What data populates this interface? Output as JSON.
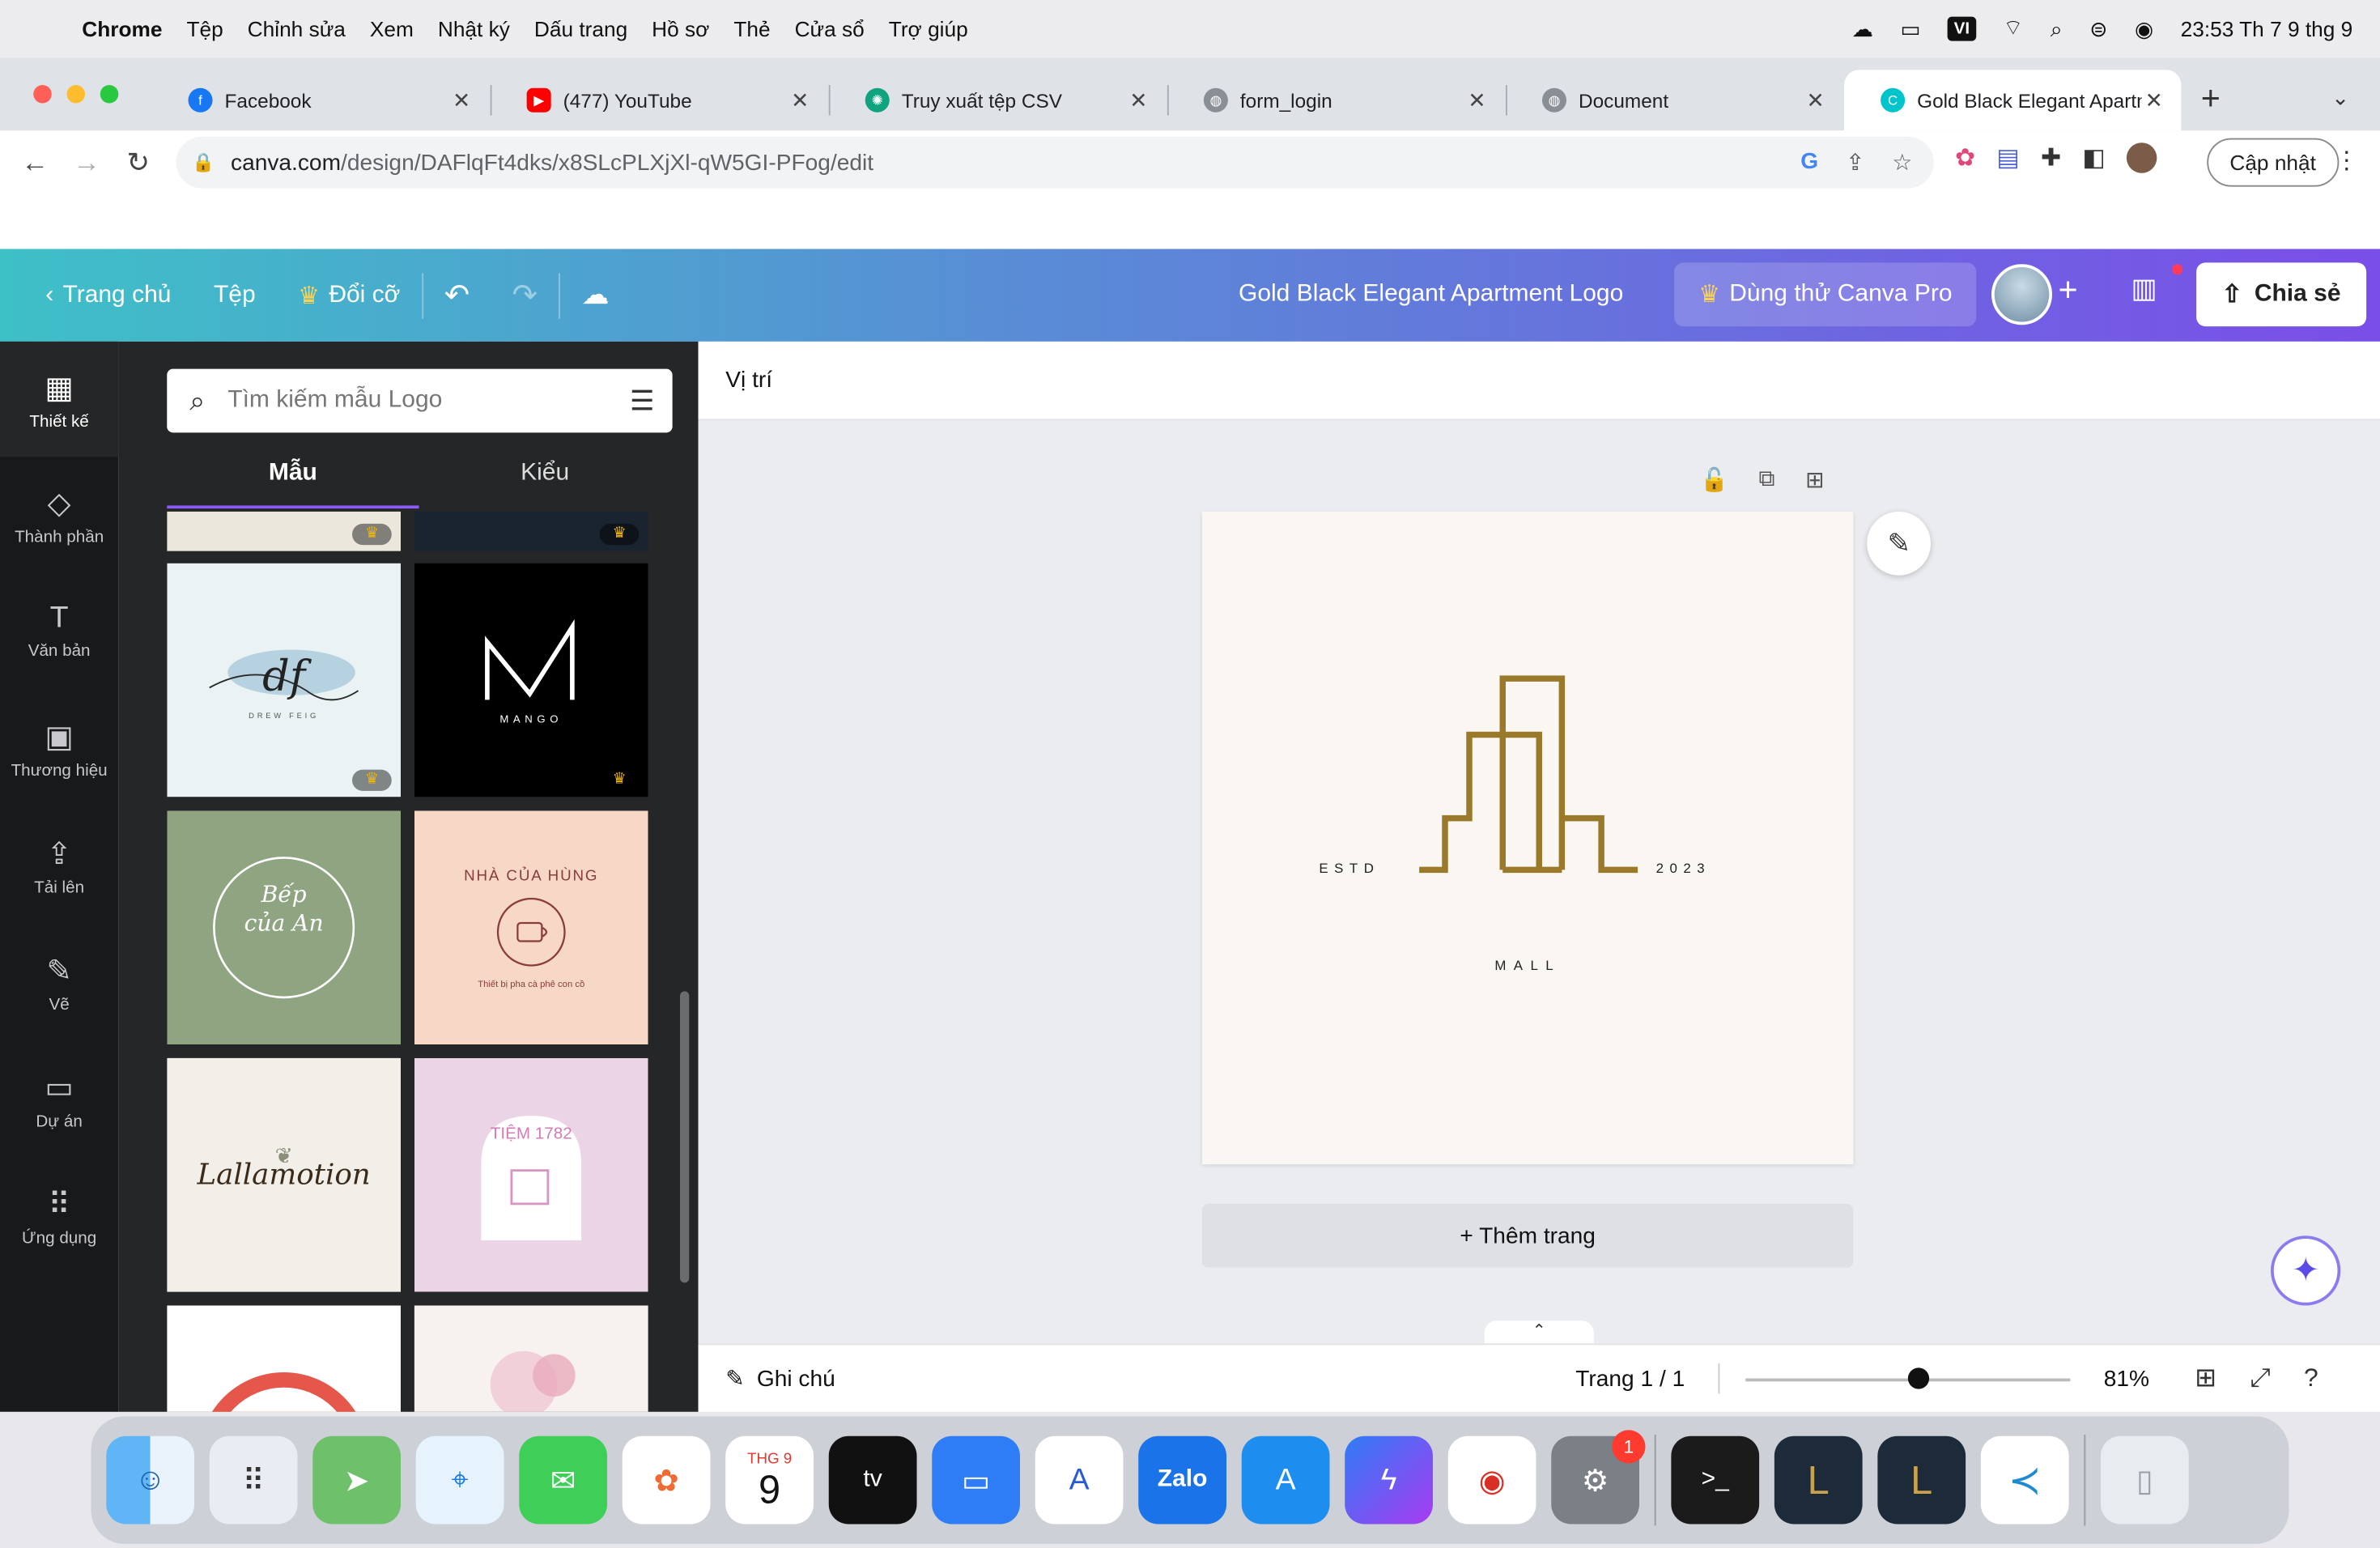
{
  "menubar": {
    "app": "Chrome",
    "items": [
      "Tệp",
      "Chỉnh sửa",
      "Xem",
      "Nhật ký",
      "Dấu trang",
      "Hồ sơ",
      "Thẻ",
      "Cửa sổ",
      "Trợ giúp"
    ],
    "input_source": "VI",
    "clock": "23:53 Th 7 9 thg 9"
  },
  "tabs": [
    {
      "label": "Facebook",
      "favicon_color": "#1877f2"
    },
    {
      "label": "(477) YouTube",
      "favicon_color": "#ff0000"
    },
    {
      "label": "Truy xuất tệp CSV",
      "favicon_color": "#10a37f"
    },
    {
      "label": "form_login",
      "favicon_color": "#8a8f96"
    },
    {
      "label": "Document",
      "favicon_color": "#8a8f96"
    },
    {
      "label": "Gold Black Elegant Apartm",
      "favicon_color": "#00c4cc"
    }
  ],
  "address_bar": {
    "host": "canva.com",
    "path": "/design/DAFlqFt4dks/x8SLcPLXjXl-qW5GI-PFog/edit"
  },
  "update_button": "Cập nhật",
  "canva_header": {
    "home": "Trang chủ",
    "file": "Tệp",
    "resize": "Đổi cỡ",
    "document_title": "Gold Black Elegant Apartment Logo",
    "try_pro": "Dùng thử Canva Pro",
    "share": "Chia sẻ"
  },
  "rail": [
    {
      "label": "Thiết kế",
      "icon": "layout-icon"
    },
    {
      "label": "Thành phần",
      "icon": "elements-icon"
    },
    {
      "label": "Văn bản",
      "icon": "text-icon"
    },
    {
      "label": "Thương hiệu",
      "icon": "brand-icon"
    },
    {
      "label": "Tải lên",
      "icon": "upload-icon"
    },
    {
      "label": "Vẽ",
      "icon": "draw-icon"
    },
    {
      "label": "Dự án",
      "icon": "folder-icon"
    },
    {
      "label": "Ứng dụng",
      "icon": "apps-icon"
    }
  ],
  "panel": {
    "search_placeholder": "Tìm kiếm mẫu Logo",
    "tabs": [
      "Mẫu",
      "Kiểu"
    ],
    "templates": [
      {
        "line1": "df",
        "line2": "DREW FEIG",
        "bg": "#eaf2f4",
        "pro": true
      },
      {
        "line1": "M",
        "line2": "MANGO",
        "bg": "#000000",
        "pro": true
      },
      {
        "line1": "Bếp của An",
        "line2": "",
        "bg": "#8fa582",
        "pro": false
      },
      {
        "line1": "NHÀ CỦA HÙNG",
        "line2": "Thiết bị pha cà phê con cồ",
        "bg": "#f7d8c6",
        "pro": false
      },
      {
        "line1": "Lallamotion",
        "line2": "",
        "bg": "#f2efe9",
        "pro": false
      },
      {
        "line1": "TIỆM 1782",
        "line2": "",
        "bg": "#ead4e6",
        "pro": false
      }
    ]
  },
  "editor": {
    "position_label": "Vị trí",
    "logo": {
      "left": "ESTD",
      "right": "2023",
      "bottom": "MALL",
      "color": "#9a7a2a"
    },
    "add_page": "+ Thêm trang",
    "notes": "Ghi chú",
    "page_info": "Trang 1 / 1",
    "zoom": "81%"
  },
  "dock": {
    "calendar_month": "THG 9",
    "calendar_day": "9",
    "settings_badge": "1"
  }
}
